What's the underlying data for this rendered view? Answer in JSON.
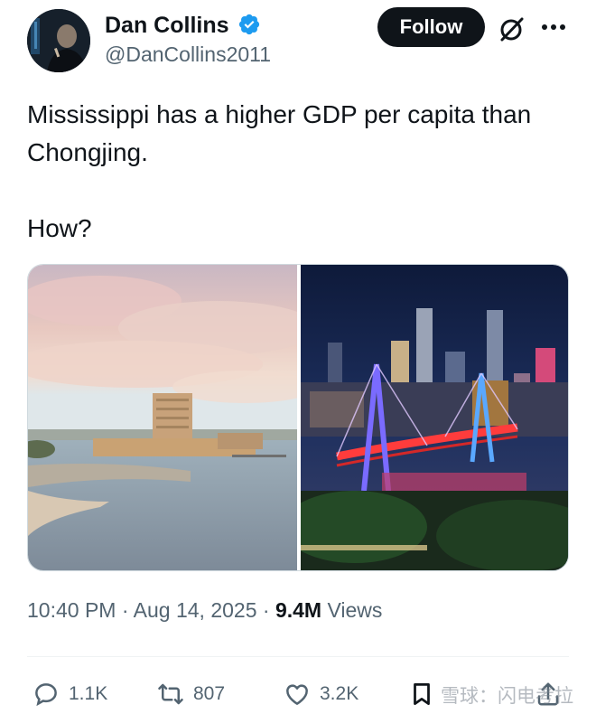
{
  "user": {
    "display_name": "Dan Collins",
    "handle": "@DanCollins2011",
    "verified": true,
    "verified_color": "#1d9bf0"
  },
  "header": {
    "follow_label": "Follow",
    "icons": [
      "grok-icon",
      "more-icon"
    ]
  },
  "tweet": {
    "line1": "Mississippi has a higher GDP per capita than Chongjing.",
    "line2": "How?"
  },
  "media": {
    "count": 2,
    "left": "photo of a coastal casino hotel at sunset with pink clouds",
    "right": "photo of a night city skyline with a lit bridge"
  },
  "meta": {
    "time": "10:40 PM",
    "separator": "·",
    "date": "Aug 14, 2025",
    "views_count": "9.4M",
    "views_label": "Views"
  },
  "actions": {
    "replies": "1.1K",
    "reposts": "807",
    "likes": "3.2K"
  },
  "watermark": "雪球：闪电考拉",
  "colors": {
    "text_primary": "#0f1419",
    "text_secondary": "#536471",
    "follow_bg": "#0f1419",
    "verified": "#1d9bf0"
  }
}
